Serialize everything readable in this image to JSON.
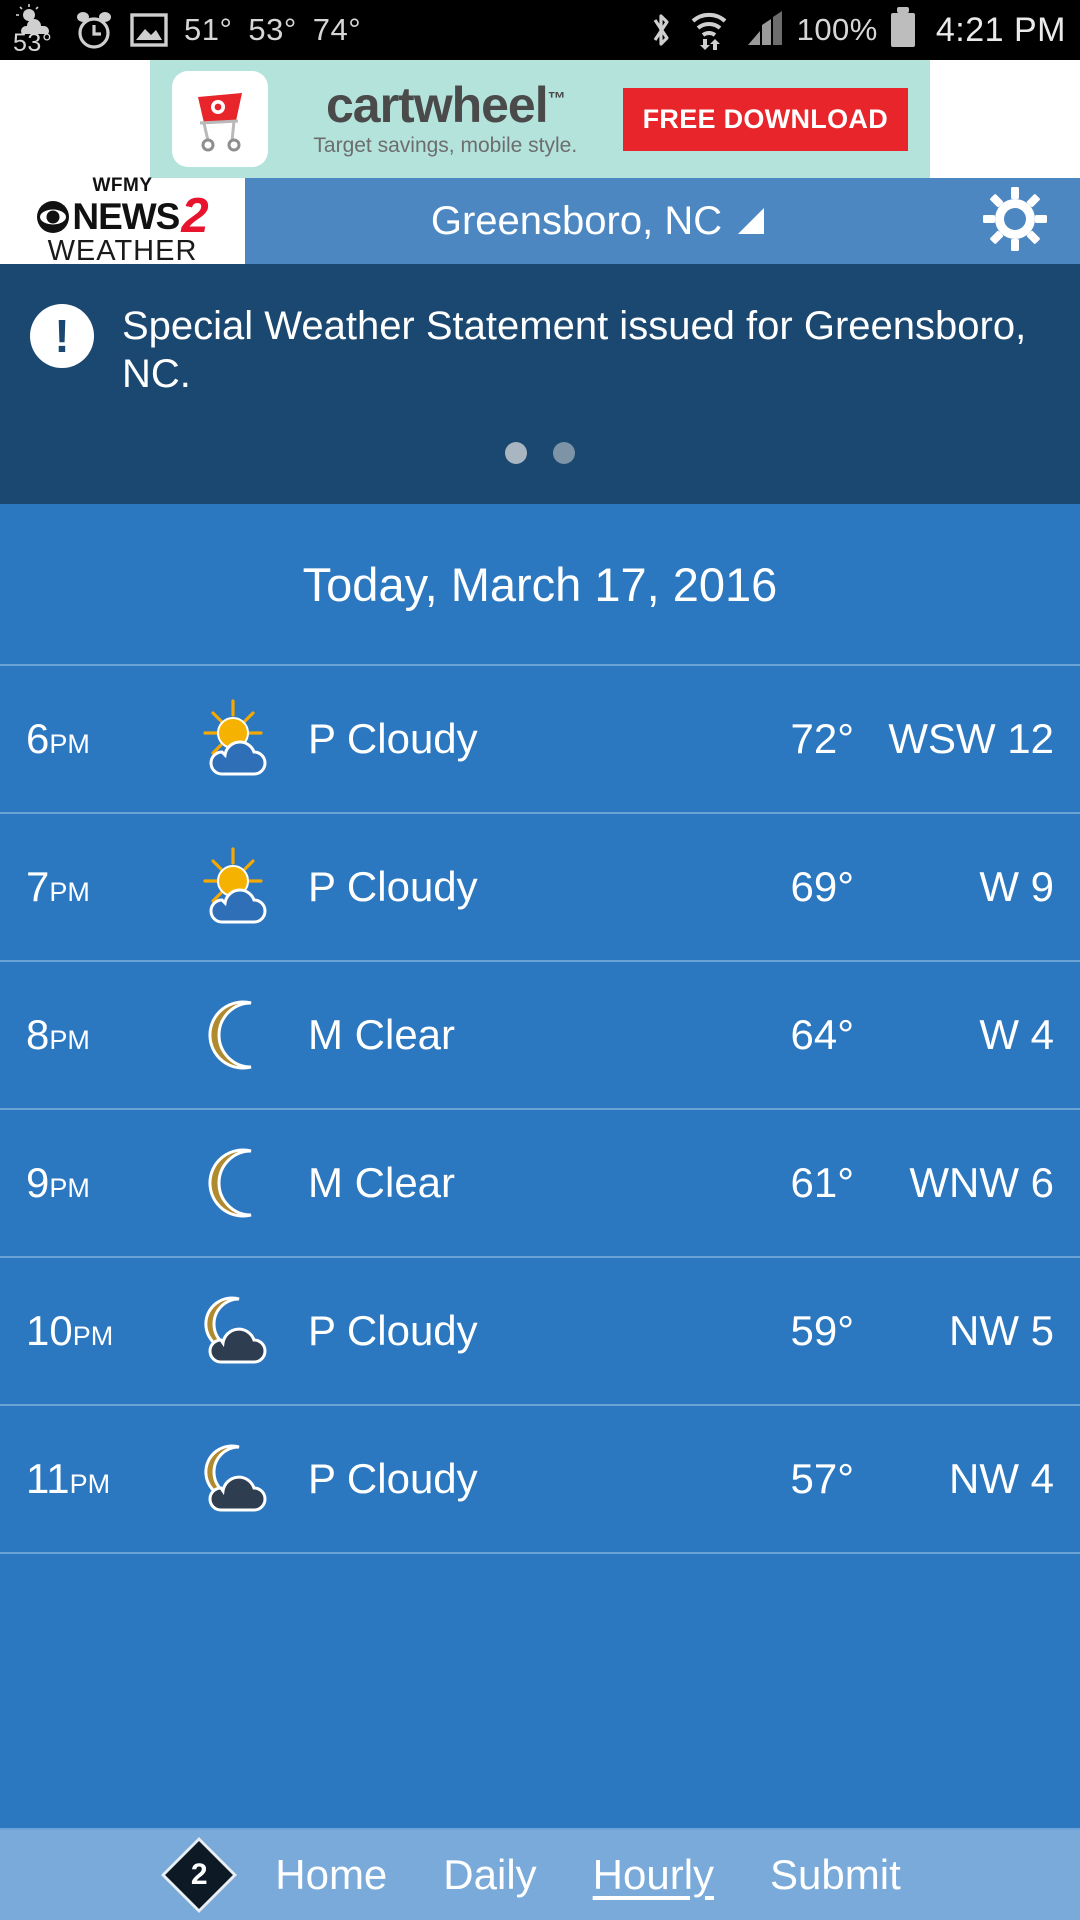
{
  "status_bar": {
    "weather_temp": "53",
    "weather_deg": "°",
    "temps": [
      "51°",
      "53°",
      "74°"
    ],
    "battery": "100%",
    "time": "4:21 PM",
    "icons": [
      "weather-partly-cloudy-icon",
      "alarm-clock-icon",
      "image-icon",
      "bluetooth-icon",
      "wifi-icon",
      "cellular-signal-icon",
      "battery-icon"
    ]
  },
  "ad": {
    "title": "cartwheel",
    "trademark": "™",
    "subtitle": "Target savings, mobile style.",
    "button": "FREE DOWNLOAD",
    "bg_color": "#b4e3dc",
    "button_color": "#e8252a"
  },
  "header": {
    "brand": {
      "line1": "WFMY",
      "line2": "NEWS",
      "number": "2",
      "line3": "WEATHER"
    },
    "location": "Greensboro, NC",
    "settings_label": "Settings",
    "bg_color": "#4c87c2"
  },
  "alert": {
    "icon": "!",
    "text": "Special Weather Statement issued for Greensboro, NC.",
    "bg_color": "#1b4870",
    "pages": 2,
    "active_page": 1
  },
  "day_header": "Today, March 17, 2016",
  "hourly": {
    "rows": [
      {
        "time": "6",
        "ampm": "PM",
        "icon": "partly-cloudy-day-icon",
        "condition": "P Cloudy",
        "temp": "72°",
        "wind": "WSW 12"
      },
      {
        "time": "7",
        "ampm": "PM",
        "icon": "partly-cloudy-day-icon",
        "condition": "P Cloudy",
        "temp": "69°",
        "wind": "W 9"
      },
      {
        "time": "8",
        "ampm": "PM",
        "icon": "moon-icon",
        "condition": "M Clear",
        "temp": "64°",
        "wind": "W 4"
      },
      {
        "time": "9",
        "ampm": "PM",
        "icon": "moon-icon",
        "condition": "M Clear",
        "temp": "61°",
        "wind": "WNW 6"
      },
      {
        "time": "10",
        "ampm": "PM",
        "icon": "partly-cloudy-night-icon",
        "condition": "P Cloudy",
        "temp": "59°",
        "wind": "NW 5"
      },
      {
        "time": "11",
        "ampm": "PM",
        "icon": "partly-cloudy-night-icon",
        "condition": "P Cloudy",
        "temp": "57°",
        "wind": "NW 4"
      }
    ]
  },
  "bottom_nav": {
    "logo_number": "2",
    "items": [
      {
        "label": "Home",
        "active": false
      },
      {
        "label": "Daily",
        "active": false
      },
      {
        "label": "Hourly",
        "active": true
      },
      {
        "label": "Submit",
        "active": false
      }
    ],
    "bg_color": "#79aada"
  }
}
